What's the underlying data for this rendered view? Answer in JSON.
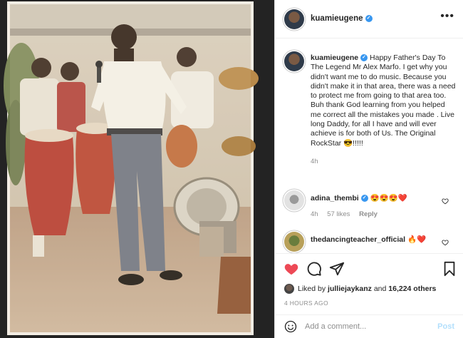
{
  "post": {
    "author": "kuamieugene",
    "more_icon": "more-horizontal-icon",
    "caption_author": "kuamieugene",
    "caption_text": "Happy Father's Day To The Legend Mr Alex Marfo. I get why you didn't want me to do music. Because you didn't make it in that area, there was a need to protect me from going to that area too. Buh thank God learning from you helped me correct all the mistakes you made . Live long Daddy, for all I have and will ever achieve is for both of Us. The Original RockStar 😎!!!!!",
    "caption_time": "4h",
    "comments": [
      {
        "user": "adina_thembi",
        "verified": true,
        "text": "😍😍😍❤️",
        "time": "4h",
        "likes": "57 likes",
        "reply": "Reply"
      },
      {
        "user": "thedancingteacher_official",
        "verified": false,
        "text": "🔥❤️"
      }
    ],
    "liked_by_prefix": "Liked by ",
    "liked_by_user": "julliejaykanz",
    "liked_by_and": " and ",
    "liked_by_count": "16,224 others",
    "posted_ago": "4 HOURS AGO",
    "comment_placeholder": "Add a comment...",
    "post_button": "Post"
  },
  "colors": {
    "like_red": "#ed4956",
    "verified_blue": "#3897f0",
    "post_button_disabled": "#b2dffc"
  }
}
